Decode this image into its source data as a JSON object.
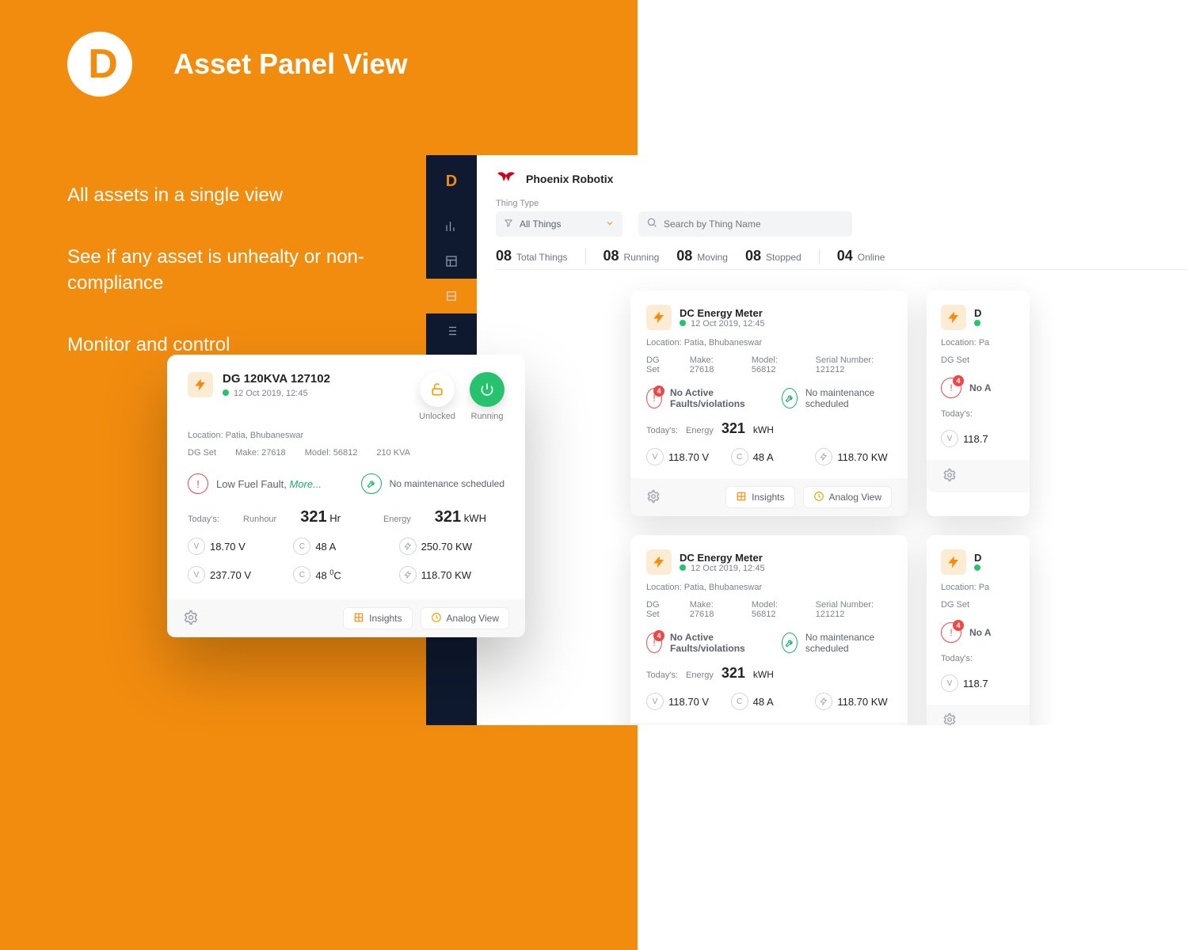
{
  "hero": {
    "title": "Asset Panel View",
    "line1": "All assets in a single view",
    "line2": "See if any asset is unhealty or non-compliance",
    "line3": "Monitor and control"
  },
  "brand": {
    "name": "Phoenix Robotix"
  },
  "filter": {
    "label": "Thing Type",
    "selected": "All Things",
    "search_placeholder": "Search by Thing Name"
  },
  "stats": {
    "total": {
      "num": "08",
      "label": "Total Things"
    },
    "running": {
      "num": "08",
      "label": "Running"
    },
    "moving": {
      "num": "08",
      "label": "Moving"
    },
    "stopped": {
      "num": "08",
      "label": "Stopped"
    },
    "online": {
      "num": "04",
      "label": "Online"
    }
  },
  "bigCard": {
    "title": "DG 120KVA 127102",
    "timestamp": "12 Oct 2019, 12:45",
    "location_label": "Location:",
    "location": "Patia, Bhubaneswar",
    "type": "DG Set",
    "make": "Make: 27618",
    "model": "Model: 56812",
    "capacity": "210 KVA",
    "state_unlocked": "Unlocked",
    "state_running": "Running",
    "fault_line": "Low Fuel Fault,",
    "fault_more": "More...",
    "maint": "No maintenance scheduled",
    "todays": "Today's:",
    "runhour_label": "Runhour",
    "runhour": "321",
    "runhour_unit": "Hr",
    "energy_label": "Energy",
    "energy": "321",
    "energy_unit": "kWH",
    "v1": "18.70 V",
    "a": "48 A",
    "kw1": "250.70 KW",
    "v2": "237.70 V",
    "temp": "48 ",
    "temp_unit": "°C",
    "kw2": "118.70 KW",
    "insights": "Insights",
    "analog": "Analog View"
  },
  "smallCard": {
    "title": "DC Energy Meter",
    "timestamp": "12 Oct 2019, 12:45",
    "location_prefix": "Location: ",
    "location": "Patia, Bhubaneswar",
    "type": "DG Set",
    "make": "Make: 27618",
    "model": "Model: 56812",
    "serial": "Serial Number: 121212",
    "fault_count": "4",
    "fault_line": "No Active Faults/violations",
    "maint": "No maintenance scheduled",
    "todays": "Today's:",
    "energy_label": "Energy",
    "energy": "321",
    "energy_unit": "kWH",
    "v": "118.70 V",
    "a": "48 A",
    "kw": "118.70 KW",
    "insights": "Insights",
    "analog": "Analog View"
  }
}
